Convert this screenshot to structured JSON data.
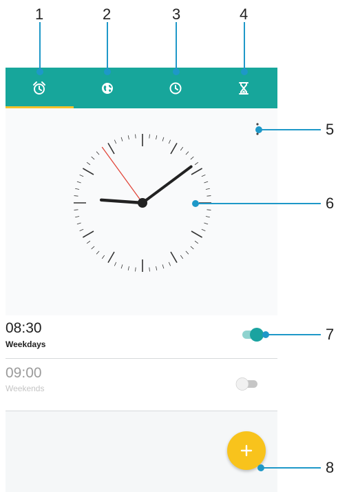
{
  "callouts": [
    "1",
    "2",
    "3",
    "4",
    "5",
    "6",
    "7",
    "8"
  ],
  "tabs": [
    {
      "icon": "alarm-clock-icon"
    },
    {
      "icon": "globe-icon"
    },
    {
      "icon": "clock-icon"
    },
    {
      "icon": "hourglass-icon"
    }
  ],
  "active_tab": 0,
  "colors": {
    "toolbar": "#17a69b",
    "tab_indicator": "#f4c22b",
    "fab": "#f8c31c",
    "callout": "#1e98c8",
    "toggle_on": "#1aa3a0"
  },
  "analog_clock": {
    "hour": 9,
    "minute": 8,
    "second": 54
  },
  "alarms": [
    {
      "time": "08:30",
      "days": "Weekdays",
      "enabled": true
    },
    {
      "time": "09:00",
      "days": "Weekends",
      "enabled": false
    }
  ],
  "fab": {
    "icon": "plus-icon"
  }
}
